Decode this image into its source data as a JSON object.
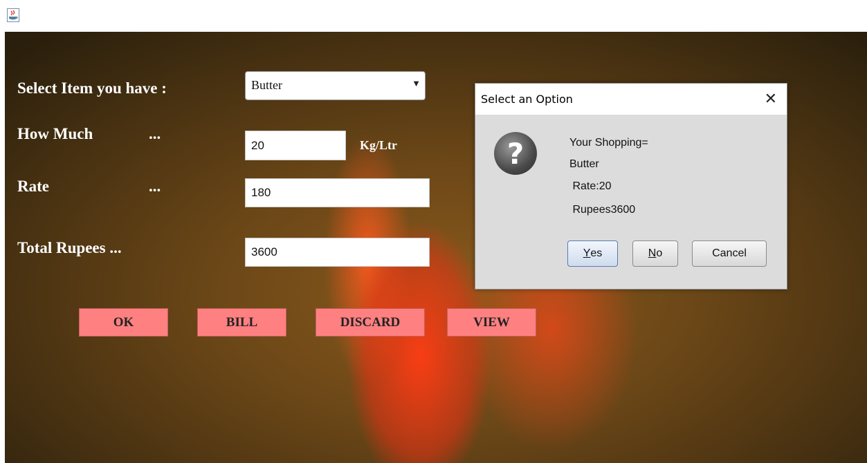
{
  "window": {
    "icon": "java-icon"
  },
  "form": {
    "item_label": "Select Item you have :",
    "item_selected": "Butter",
    "quantity_label": "How Much",
    "quantity_dots": "...",
    "quantity_value": "20",
    "quantity_unit": "Kg/Ltr",
    "rate_label": "Rate",
    "rate_dots": "...",
    "rate_value": "180",
    "total_label": "Total Rupees ...",
    "total_value": "3600"
  },
  "buttons": {
    "ok": "OK",
    "bill": "BILL",
    "discard": "DISCARD",
    "view": "VIEW"
  },
  "dialog": {
    "title": "Select an Option",
    "icon": "question-icon",
    "lines": [
      "Your Shopping=",
      "Butter",
      " Rate:20",
      " Rupees3600"
    ],
    "yes_mnemonic": "Y",
    "yes_rest": "es",
    "no_mnemonic": "N",
    "no_rest": "o",
    "cancel": "Cancel"
  },
  "colors": {
    "button_bg": "#ff8080",
    "dialog_bg": "#dcdcdc"
  }
}
